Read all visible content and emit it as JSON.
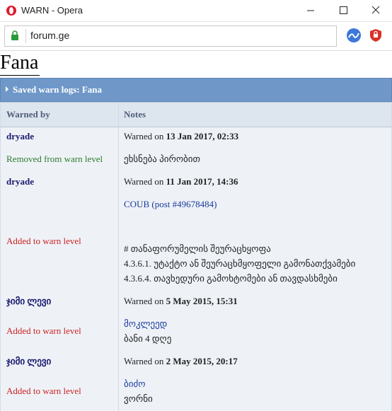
{
  "window": {
    "title": "WARN - Opera",
    "url": "forum.ge"
  },
  "page": {
    "heading": "Fana",
    "log_title": "Saved warn logs: Fana",
    "columns": {
      "warned_by": "Warned by",
      "notes": "Notes"
    }
  },
  "entries": [
    {
      "user": "dryade",
      "warned_prefix": "Warned on ",
      "date": "13 Jan 2017, 02:33",
      "action": "Removed from warn level",
      "notes": [
        "ეხსნება პირობით"
      ]
    },
    {
      "user": "dryade",
      "warned_prefix": "Warned on ",
      "date": "11 Jan 2017, 14:36",
      "action": "Added to warn level",
      "link": "COUB (post #49678484)",
      "notes": [
        "# თანაფორუმელის შეურაცხყოფა",
        "4.3.6.1. უტაქტო ან შეურაცხმყოფელი გამონათქვამები",
        "4.3.6.4. თავხედური გამოხტომები ან თავდასხმები"
      ]
    },
    {
      "user": "ჯიმი ლევი",
      "warned_prefix": "Warned on ",
      "date": "5 May 2015, 15:31",
      "action": "Added to warn level",
      "notes": [
        "მოკლეედ",
        "ბანი 4 დღე"
      ]
    },
    {
      "user": "ჯიმი ლევი",
      "warned_prefix": "Warned on ",
      "date": "2 May 2015, 20:17",
      "action": "Added to warn level",
      "notes": [
        "ბიძო",
        "ვორნი"
      ]
    }
  ],
  "colors": {
    "header_bar": "#6f98c9",
    "table_bg": "#eef2f7",
    "removed": "#2f7a2f",
    "added": "#cc2222",
    "username": "#1a1a6e"
  }
}
